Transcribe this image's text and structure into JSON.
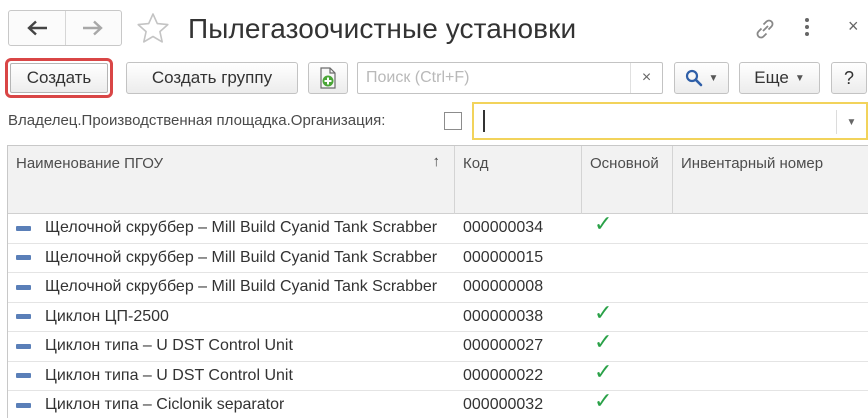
{
  "header": {
    "title": "Пылегазоочистные установки",
    "nav_icons": [
      "arrow-left-icon",
      "arrow-right-icon"
    ],
    "favorite_icon": "star-icon",
    "link_icon": "link-icon",
    "more_icon": "vertical-dots-icon",
    "close_glyph": "×"
  },
  "toolbar": {
    "create_label": "Создать",
    "create_group_label": "Создать группу",
    "copy_icon": "copy-add-icon",
    "search_placeholder": "Поиск (Ctrl+F)",
    "search_clear": "×",
    "find_icon": "magnifier-icon",
    "more_label": "Еще",
    "help_label": "?"
  },
  "filter": {
    "label": "Владелец.Производственная площадка.Организация:",
    "checked": false,
    "value": ""
  },
  "table": {
    "columns": [
      {
        "label": "Наименование ПГОУ",
        "sort": "↑"
      },
      {
        "label": "Код"
      },
      {
        "label": "Основной"
      },
      {
        "label": "Инвентарный номер"
      }
    ],
    "rows": [
      {
        "name": "Щелочной скруббер – Mill Build Cyanid  Tank  Scrabber",
        "code": "000000034",
        "main": "✓"
      },
      {
        "name": "Щелочной скруббер – Mill Build Cyanid  Tank  Scrabber",
        "code": "000000015",
        "main": ""
      },
      {
        "name": "Щелочной скруббер – Mill Build Cyanid  Tank  Scrabber",
        "code": "000000008",
        "main": ""
      },
      {
        "name": "Циклон ЦП-2500",
        "code": "000000038",
        "main": "✓"
      },
      {
        "name": "Циклон типа – U DST Control Unit",
        "code": "000000027",
        "main": "✓"
      },
      {
        "name": "Циклон типа – U DST Control Unit",
        "code": "000000022",
        "main": "✓"
      },
      {
        "name": "Циклон типа – Ciclonik separator",
        "code": "000000032",
        "main": "✓"
      }
    ]
  },
  "colors": {
    "highlight_border": "#d94646",
    "focus_border": "#f2d35b",
    "check": "#2aa148",
    "item_icon": "#5a7fb8"
  }
}
